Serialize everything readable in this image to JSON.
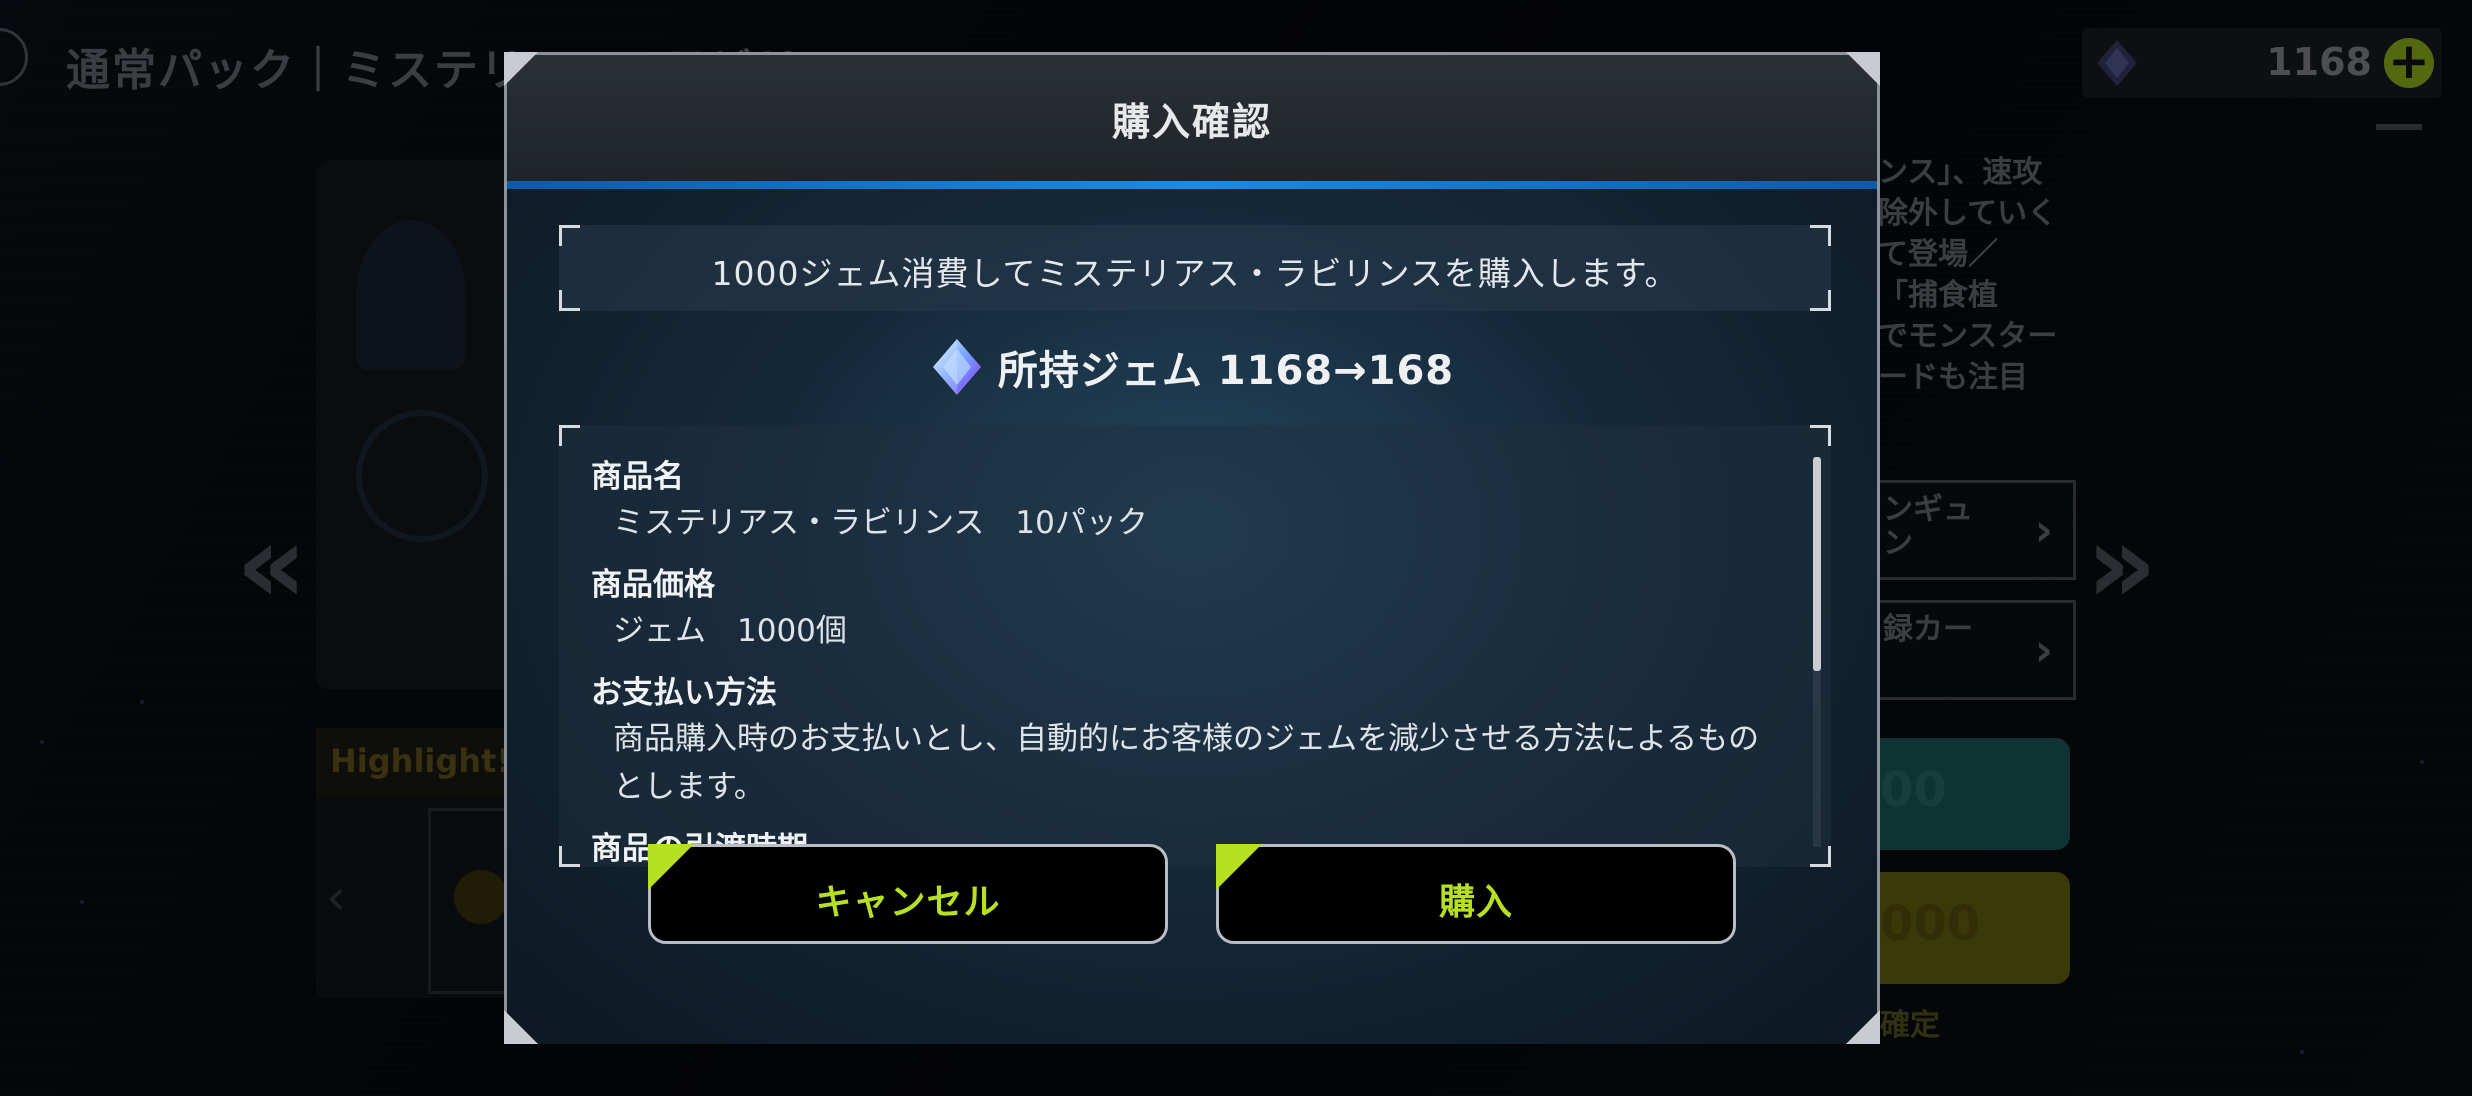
{
  "background": {
    "page_title": "通常パック｜ミステリアス・ラビリンス",
    "gem_balance": "1168",
    "description_lines": [
      "ンス」、速攻",
      "除外していく",
      "て登場／",
      "「捕食植",
      "でモンスター",
      "ードも注目"
    ],
    "side_buttons": [
      {
        "label": "ンギュ\nン"
      },
      {
        "label": "録カー"
      }
    ],
    "price_buttons": [
      {
        "label": "00"
      },
      {
        "label": "000"
      }
    ],
    "bottom_text": "確定",
    "highlight_label": "Highlight!"
  },
  "dialog": {
    "title": "購入確認",
    "message": "1000ジェム消費してミステリアス・ラビリンスを購入します。",
    "gem_change": "所持ジェム 1168→168",
    "details": [
      {
        "label": "商品名",
        "value": "ミステリアス・ラビリンス　10パック"
      },
      {
        "label": "商品価格",
        "value": "ジェム　1000個"
      },
      {
        "label": "お支払い方法",
        "value": "商品購入時のお支払いとし、自動的にお客様のジェムを減少させる方法によるものとします。"
      },
      {
        "label": "商品の引渡時期",
        "value": ""
      }
    ],
    "scroll_position": 0,
    "cancel_label": "キャンセル",
    "buy_label": "購入"
  },
  "colors": {
    "accent_green": "#b7e021",
    "accent_blue": "#1c8be0"
  },
  "icons": [
    "gem-icon",
    "add-icon",
    "chevron-right-icon",
    "chevron-left-icon",
    "play-icon"
  ]
}
